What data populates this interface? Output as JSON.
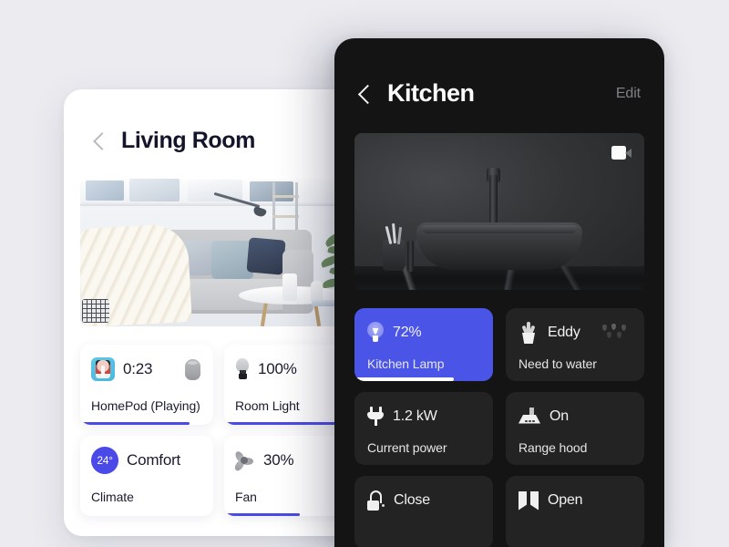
{
  "background": {
    "page_color": "#ebebf0"
  },
  "living_room": {
    "title": "Living Room",
    "back_icon": "chevron-left-icon",
    "photo_alt": "living-room-photo",
    "cards": [
      {
        "icon": "album-art-icon",
        "secondary_icon": "homepod-icon",
        "value": "0:23",
        "label": "HomePod (Playing)",
        "progress": 82,
        "accent": "#4a4ae8"
      },
      {
        "icon": "light-bulb-icon",
        "value": "100%",
        "label": "Room Light",
        "progress": 100,
        "accent": "#4a4ae8"
      },
      {
        "icon": "temperature-badge",
        "badge_value": "24°",
        "value": "Comfort",
        "label": "Climate",
        "progress": 0,
        "accent": "#4a4ae8"
      },
      {
        "icon": "fan-icon",
        "value": "30%",
        "label": "Fan",
        "progress": 57,
        "accent": "#4a4ae8"
      }
    ]
  },
  "kitchen": {
    "title": "Kitchen",
    "back_icon": "chevron-left-icon",
    "edit_label": "Edit",
    "photo_alt": "kitchen-sink-camera-feed",
    "camera_icon": "video-camera-icon",
    "accent": "#4a55e8",
    "card_bg": "#232323",
    "panel_bg": "#141414",
    "cards": [
      {
        "icon": "light-bulb-icon",
        "value": "72%",
        "label": "Kitchen Lamp",
        "active": true,
        "progress": 72
      },
      {
        "icon": "potted-plant-icon",
        "secondary_icon": "water-drops-icon",
        "value": "Eddy",
        "label": "Need to water",
        "active": false,
        "progress": 0
      },
      {
        "icon": "power-plug-icon",
        "value": "1.2 kW",
        "label": "Current power",
        "active": false,
        "progress": 0
      },
      {
        "icon": "range-hood-icon",
        "value": "On",
        "label": "Range hood",
        "active": false,
        "progress": 0
      },
      {
        "icon": "lock-icon",
        "value": "Close",
        "label": "",
        "active": false,
        "progress": 0
      },
      {
        "icon": "curtains-icon",
        "value": "Open",
        "label": "",
        "active": false,
        "progress": 0
      }
    ]
  }
}
